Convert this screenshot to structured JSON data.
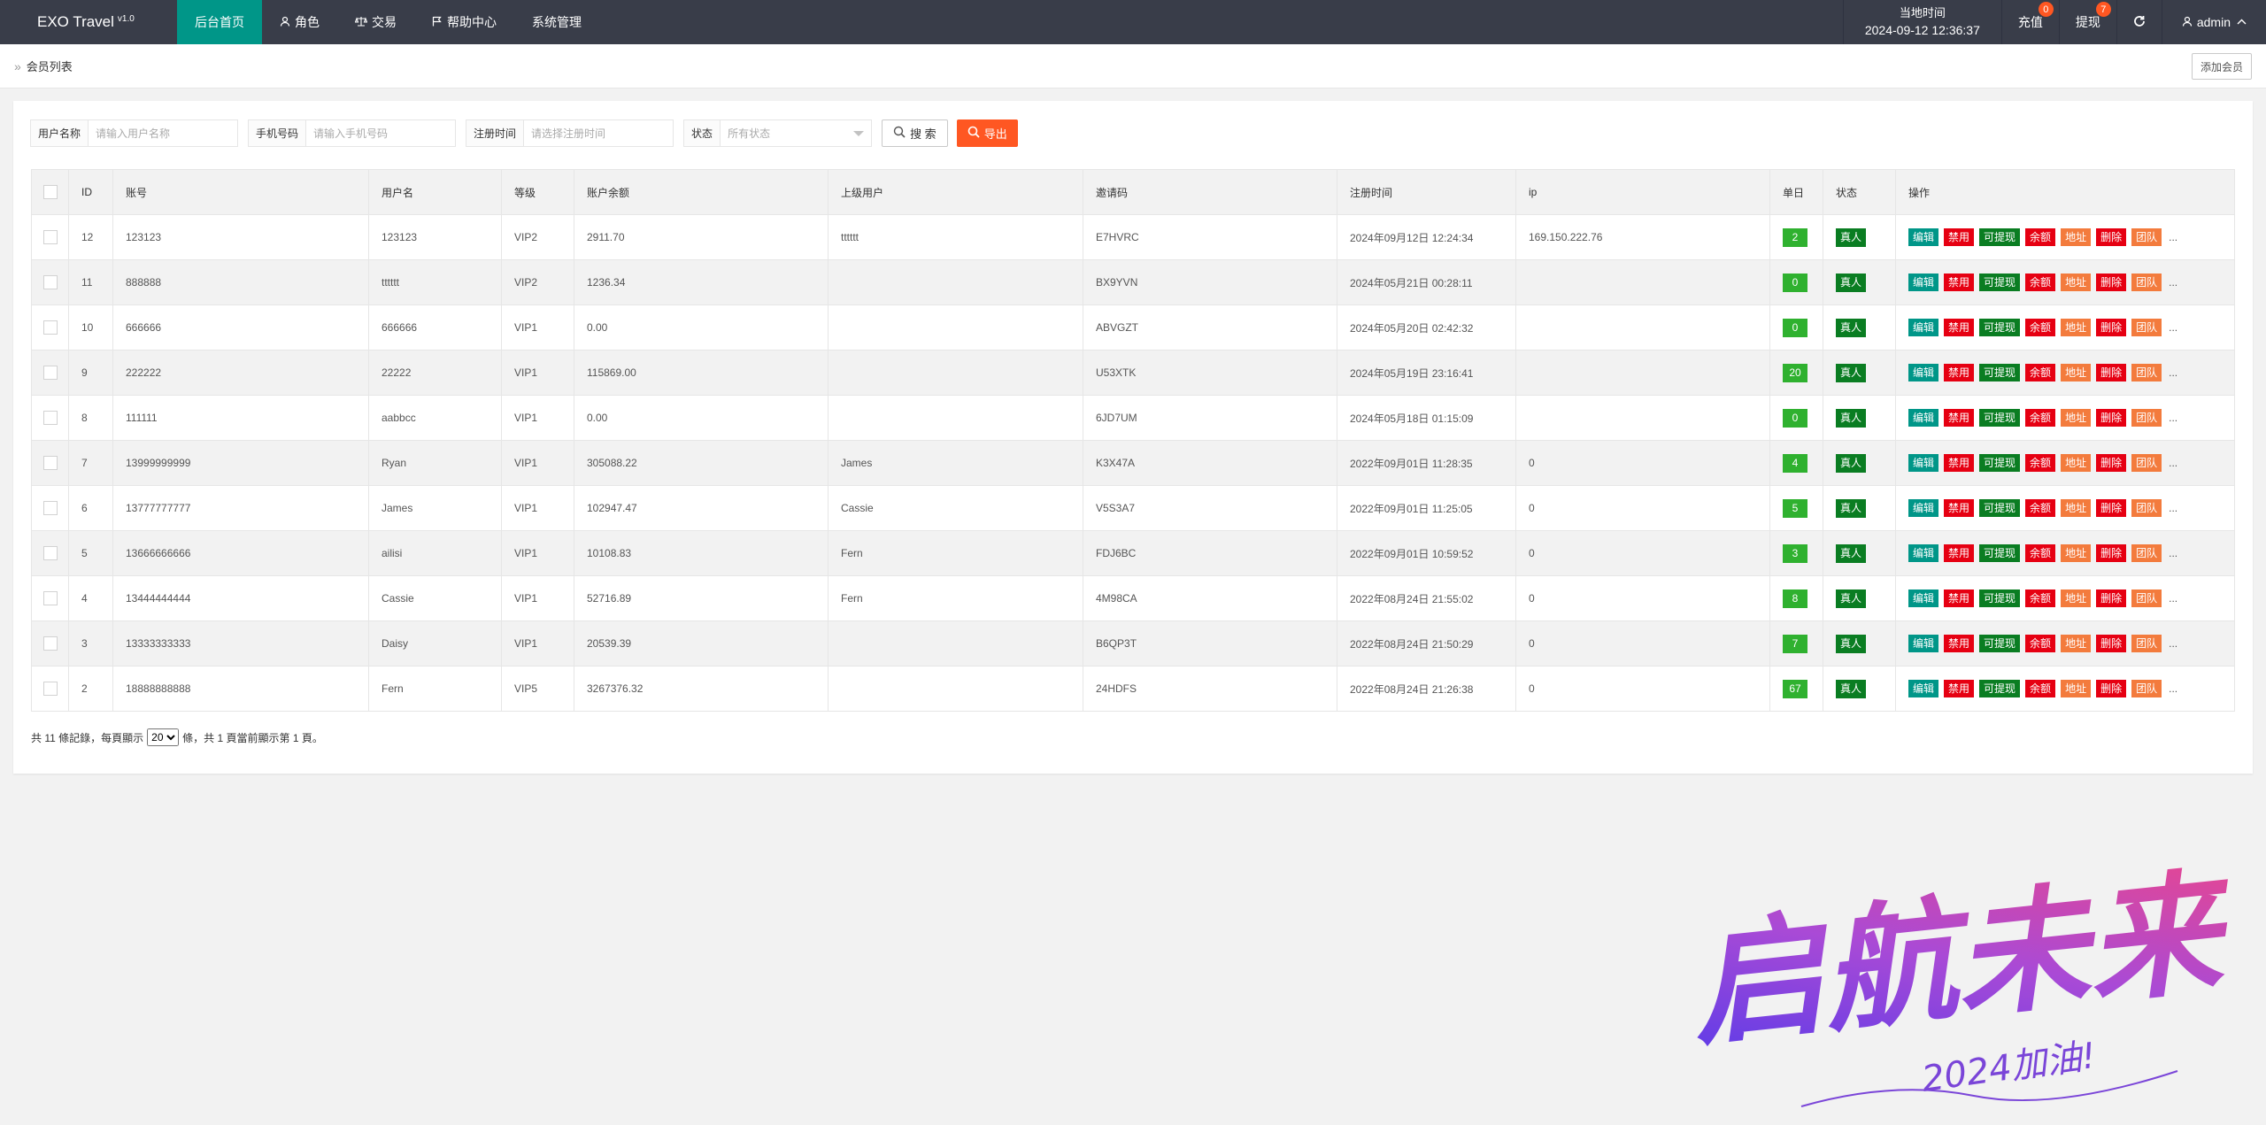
{
  "app": {
    "title": "EXO Travel",
    "version": "v1.0"
  },
  "nav": {
    "items": [
      {
        "label": "后台首页",
        "icon": "",
        "active": true
      },
      {
        "label": "角色",
        "icon": "user-icon",
        "active": false
      },
      {
        "label": "交易",
        "icon": "scale-icon",
        "active": false
      },
      {
        "label": "帮助中心",
        "icon": "flag-icon",
        "active": false
      },
      {
        "label": "系统管理",
        "icon": "",
        "active": false
      }
    ]
  },
  "header_right": {
    "time_label": "当地时间",
    "time_value": "2024-09-12 12:36:37",
    "recharge_label": "充值",
    "recharge_badge": "0",
    "withdraw_label": "提现",
    "withdraw_badge": "7",
    "refresh_icon": "refresh-icon",
    "admin_label": "admin"
  },
  "breadcrumb": {
    "label": "会员列表"
  },
  "add_member_label": "添加会员",
  "filters": {
    "username": {
      "label": "用户名称",
      "placeholder": "请输入用户名称"
    },
    "phone": {
      "label": "手机号码",
      "placeholder": "请输入手机号码"
    },
    "reg_time": {
      "label": "注册时间",
      "placeholder": "请选择注册时间"
    },
    "status": {
      "label": "状态",
      "value": "所有状态"
    },
    "search_label": "搜 索",
    "export_label": "导出"
  },
  "table": {
    "headers": [
      "ID",
      "账号",
      "用户名",
      "等级",
      "账户余额",
      "上级用户",
      "邀请码",
      "注册时间",
      "ip",
      "单日",
      "状态",
      "操作"
    ],
    "action_labels": {
      "edit": "编辑",
      "ban": "禁用",
      "withdraw": "可提现",
      "balance": "余额",
      "addr": "地址",
      "del": "删除",
      "team": "团队",
      "more": "..."
    },
    "rows": [
      {
        "id": "12",
        "account": "123123",
        "username": "123123",
        "level": "VIP2",
        "balance": "2911.70",
        "parent": "tttttt",
        "invite": "E7HVRC",
        "reg_time": "2024年09月12日 12:24:34",
        "ip": "169.150.222.76",
        "daily": "2",
        "status": "真人"
      },
      {
        "id": "11",
        "account": "888888",
        "username": "tttttt",
        "level": "VIP2",
        "balance": "1236.34",
        "parent": "",
        "invite": "BX9YVN",
        "reg_time": "2024年05月21日 00:28:11",
        "ip": "",
        "daily": "0",
        "status": "真人"
      },
      {
        "id": "10",
        "account": "666666",
        "username": "666666",
        "level": "VIP1",
        "balance": "0.00",
        "parent": "",
        "invite": "ABVGZT",
        "reg_time": "2024年05月20日 02:42:32",
        "ip": "",
        "daily": "0",
        "status": "真人"
      },
      {
        "id": "9",
        "account": "222222",
        "username": "22222",
        "level": "VIP1",
        "balance": "115869.00",
        "parent": "",
        "invite": "U53XTK",
        "reg_time": "2024年05月19日 23:16:41",
        "ip": "",
        "daily": "20",
        "status": "真人"
      },
      {
        "id": "8",
        "account": "111111",
        "username": "aabbcc",
        "level": "VIP1",
        "balance": "0.00",
        "parent": "",
        "invite": "6JD7UM",
        "reg_time": "2024年05月18日 01:15:09",
        "ip": "",
        "daily": "0",
        "status": "真人"
      },
      {
        "id": "7",
        "account": "13999999999",
        "username": "Ryan",
        "level": "VIP1",
        "balance": "305088.22",
        "parent": "James",
        "invite": "K3X47A",
        "reg_time": "2022年09月01日 11:28:35",
        "ip": "0",
        "daily": "4",
        "status": "真人"
      },
      {
        "id": "6",
        "account": "13777777777",
        "username": "James",
        "level": "VIP1",
        "balance": "102947.47",
        "parent": "Cassie",
        "invite": "V5S3A7",
        "reg_time": "2022年09月01日 11:25:05",
        "ip": "0",
        "daily": "5",
        "status": "真人"
      },
      {
        "id": "5",
        "account": "13666666666",
        "username": "ailisi",
        "level": "VIP1",
        "balance": "10108.83",
        "parent": "Fern",
        "invite": "FDJ6BC",
        "reg_time": "2022年09月01日 10:59:52",
        "ip": "0",
        "daily": "3",
        "status": "真人"
      },
      {
        "id": "4",
        "account": "13444444444",
        "username": "Cassie",
        "level": "VIP1",
        "balance": "52716.89",
        "parent": "Fern",
        "invite": "4M98CA",
        "reg_time": "2022年08月24日 21:55:02",
        "ip": "0",
        "daily": "8",
        "status": "真人"
      },
      {
        "id": "3",
        "account": "13333333333",
        "username": "Daisy",
        "level": "VIP1",
        "balance": "20539.39",
        "parent": "",
        "invite": "B6QP3T",
        "reg_time": "2022年08月24日 21:50:29",
        "ip": "0",
        "daily": "7",
        "status": "真人"
      },
      {
        "id": "2",
        "account": "18888888888",
        "username": "Fern",
        "level": "VIP5",
        "balance": "3267376.32",
        "parent": "",
        "invite": "24HDFS",
        "reg_time": "2022年08月24日 21:26:38",
        "ip": "0",
        "daily": "67",
        "status": "真人"
      }
    ]
  },
  "pagination": {
    "prefix": "共 11 條記錄，每頁顯示",
    "page_size": "20",
    "suffix": "條，共 1 頁當前顯示第 1 頁。"
  },
  "watermark": {
    "main": "启航未来",
    "sub": "2024加油!"
  },
  "colors": {
    "topbar": "#393d49",
    "active_nav": "#009688",
    "export": "#ff5722",
    "edit": "#009688",
    "danger": "#e60012",
    "green": "#0a7d22",
    "orange": "#f37b3d",
    "daily": "#2fb12f"
  }
}
